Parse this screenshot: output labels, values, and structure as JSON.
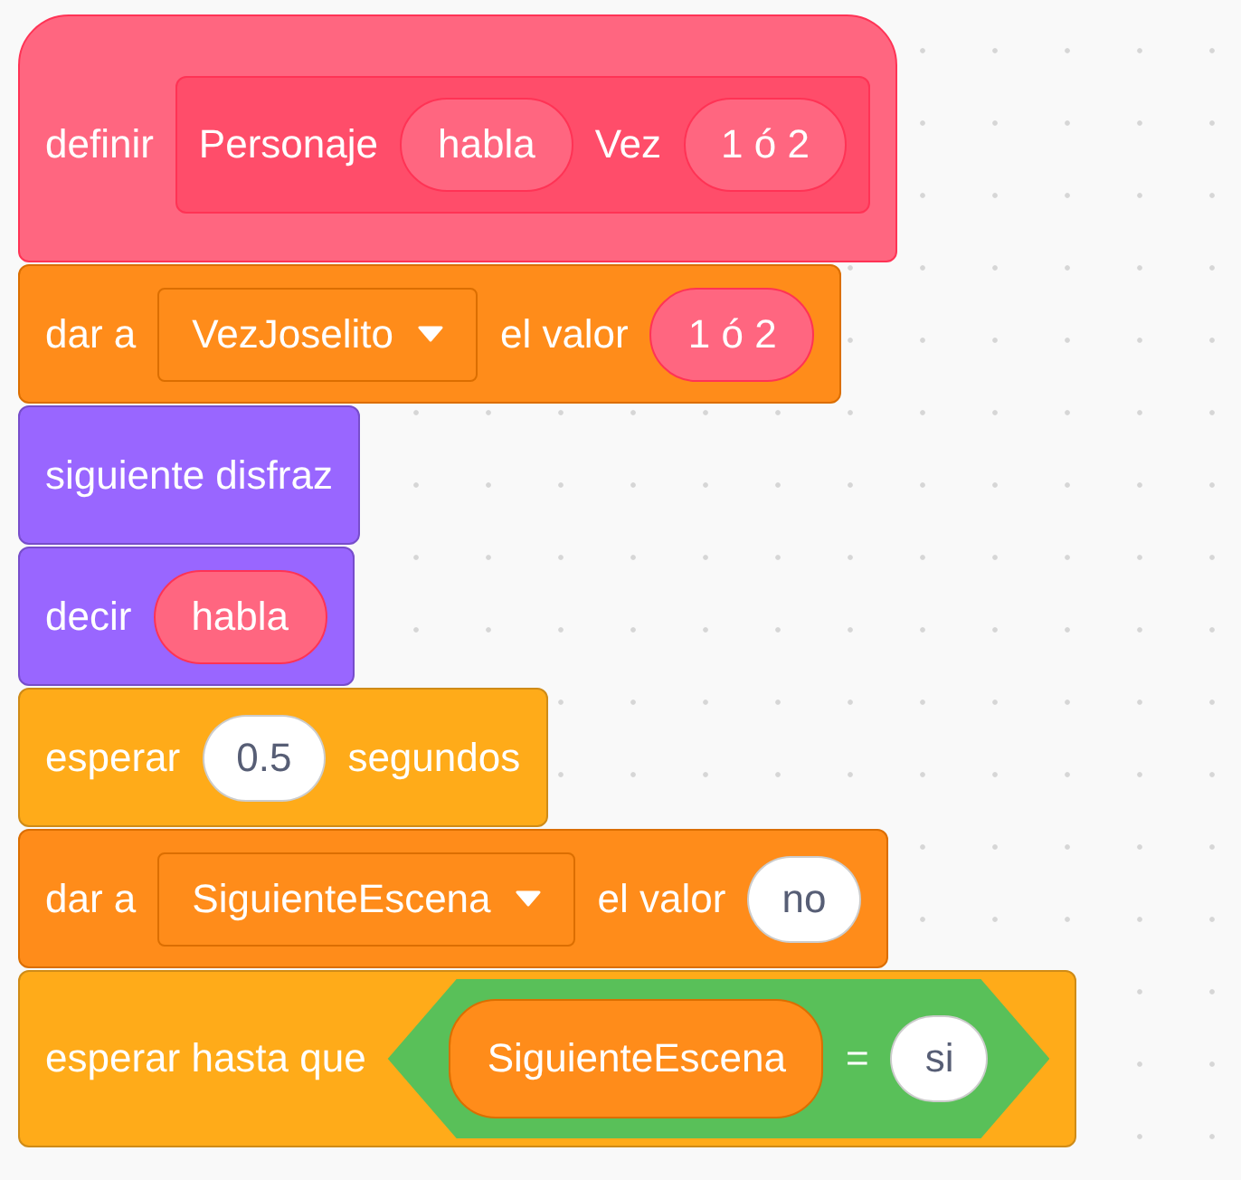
{
  "blocks": [
    {
      "kind": "define",
      "parts": [
        {
          "kind": "label",
          "text": "definir"
        },
        {
          "kind": "custom",
          "parts": [
            {
              "kind": "label",
              "text": "Personaje"
            },
            {
              "kind": "arg",
              "text": "habla"
            },
            {
              "kind": "label",
              "text": "Vez"
            },
            {
              "kind": "arg",
              "text": "1 ó 2"
            }
          ]
        }
      ]
    },
    {
      "kind": "data",
      "parts": [
        {
          "kind": "label",
          "text": "dar a"
        },
        {
          "kind": "dropdown",
          "text": "VezJoselito"
        },
        {
          "kind": "label",
          "text": "el valor"
        },
        {
          "kind": "arg",
          "text": "1 ó 2"
        }
      ]
    },
    {
      "kind": "looks",
      "parts": [
        {
          "kind": "label",
          "text": "siguiente disfraz"
        }
      ]
    },
    {
      "kind": "looks",
      "parts": [
        {
          "kind": "label",
          "text": "decir"
        },
        {
          "kind": "arg",
          "text": "habla"
        }
      ]
    },
    {
      "kind": "control",
      "parts": [
        {
          "kind": "label",
          "text": "esperar"
        },
        {
          "kind": "input",
          "text": "0.5"
        },
        {
          "kind": "label",
          "text": "segundos"
        }
      ]
    },
    {
      "kind": "data",
      "parts": [
        {
          "kind": "label",
          "text": "dar a"
        },
        {
          "kind": "dropdown",
          "text": "SiguienteEscena"
        },
        {
          "kind": "label",
          "text": "el valor"
        },
        {
          "kind": "input",
          "text": "no"
        }
      ]
    },
    {
      "kind": "control",
      "parts": [
        {
          "kind": "label",
          "text": "esperar hasta que"
        },
        {
          "kind": "boolean",
          "parts": [
            {
              "kind": "variable",
              "text": "SiguienteEscena"
            },
            {
              "kind": "label",
              "text": "="
            },
            {
              "kind": "input",
              "text": "si"
            }
          ]
        }
      ]
    }
  ]
}
